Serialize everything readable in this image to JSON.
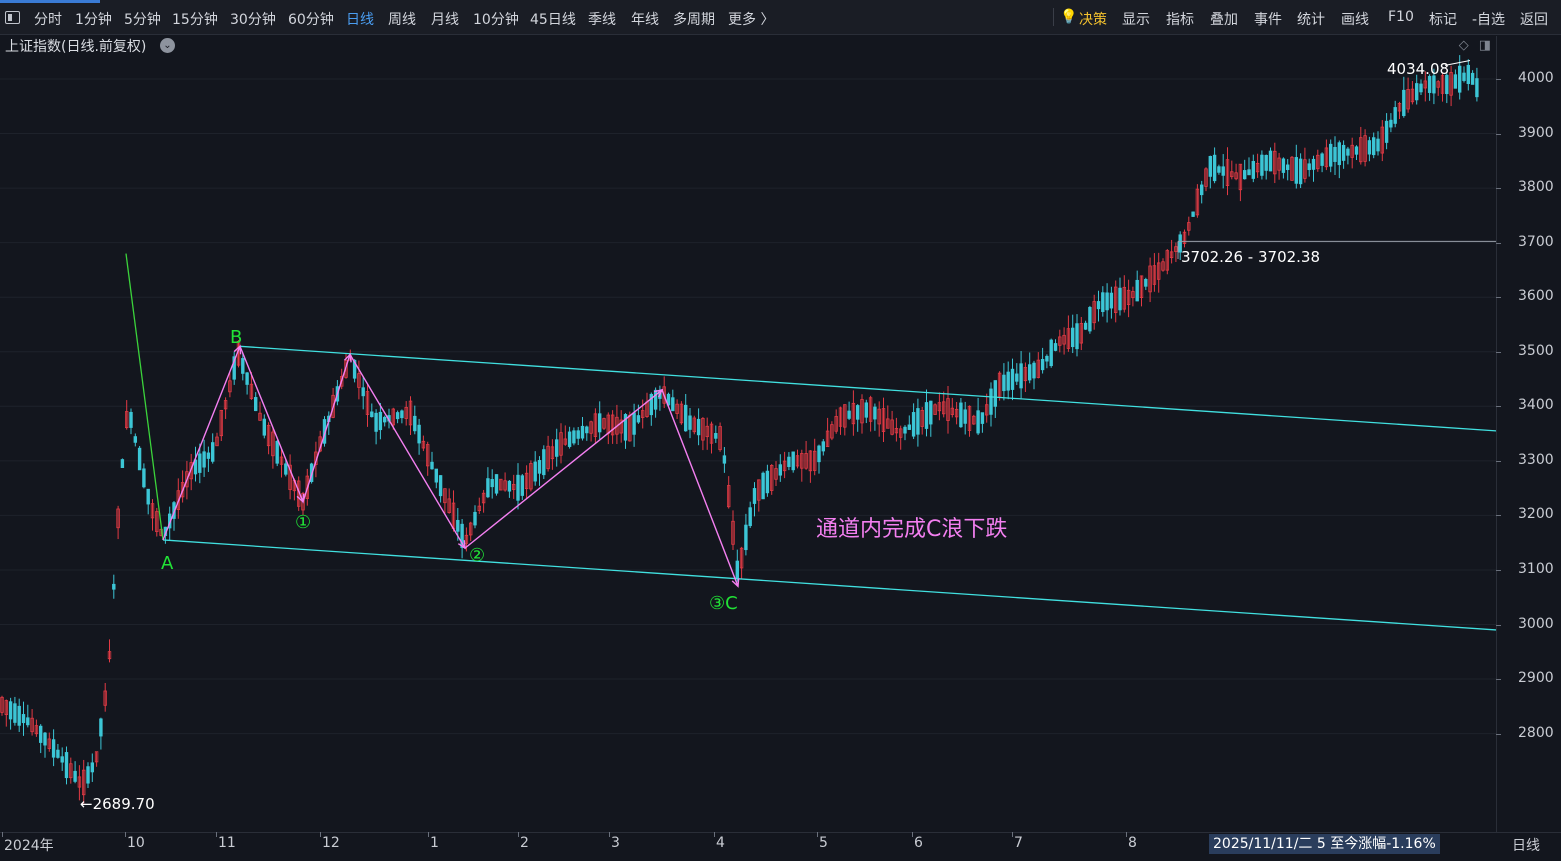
{
  "toolbar": {
    "items": [
      "分时",
      "1分钟",
      "5分钟",
      "15分钟",
      "30分钟",
      "60分钟",
      "日线",
      "周线",
      "月线",
      "10分钟",
      "45日线",
      "季线",
      "年线",
      "多周期",
      "更多 〉"
    ],
    "active_index": 6,
    "right_items": [
      "决策",
      "显示",
      "指标",
      "叠加",
      "事件",
      "统计",
      "画线",
      "F10",
      "标记",
      "-自选",
      "返回"
    ]
  },
  "chart_title": "上证指数(日线.前复权)",
  "y_axis": {
    "ticks": [
      "4000",
      "3900",
      "3800",
      "3700",
      "3600",
      "3500",
      "3400",
      "3300",
      "3200",
      "3100",
      "3000",
      "2900",
      "2800"
    ]
  },
  "x_axis": {
    "labels": [
      "2024年",
      "10",
      "11",
      "12",
      "1",
      "2",
      "3",
      "4",
      "5",
      "6",
      "7",
      "8"
    ]
  },
  "annotations": {
    "high_label": "4034.08",
    "low_label": "2689.70",
    "range_label": "3702.26 - 3702.38",
    "channel_note": "通道内完成C浪下跌"
  },
  "wave_labels": {
    "A": "A",
    "B": "B",
    "w1": "①",
    "w2": "②",
    "w3C": "③C"
  },
  "status_bar": "2025/11/11/二 5 至今涨幅-1.16%",
  "period_label": "日线",
  "colors": {
    "up": "#e23a44",
    "down": "#3cc6d6",
    "channel": "#41e0e0",
    "wave": "#f37ff0",
    "wave_label": "#21e336",
    "active": "#4a9df0"
  },
  "chart_data": {
    "type": "candlestick",
    "title": "上证指数(日线.前复权)",
    "ylim": [
      2650,
      4080
    ],
    "y_ticks": [
      2800,
      2900,
      3000,
      3100,
      3200,
      3300,
      3400,
      3500,
      3600,
      3700,
      3800,
      3900,
      4000
    ],
    "x_labels": [
      "2024年",
      "10",
      "11",
      "12",
      "1",
      "2",
      "3",
      "4",
      "5",
      "6",
      "7",
      "8"
    ],
    "points": {
      "low_2024_09": 2689.7,
      "A": 3155,
      "B": 3510,
      "w1": 3225,
      "peak2": 3495,
      "w2": 3140,
      "peak3": 3430,
      "w3C": 3070,
      "breakout_level": 3702.26,
      "high": 4034.08
    },
    "channel": {
      "upper": [
        3510,
        3355
      ],
      "lower": [
        3155,
        2990
      ]
    }
  }
}
